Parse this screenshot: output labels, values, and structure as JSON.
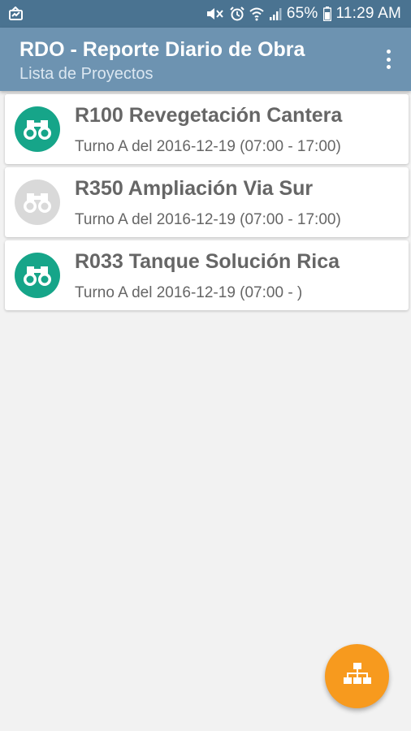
{
  "status_bar": {
    "battery_percent": "65%",
    "time": "11:29 AM",
    "icons": [
      "notification-icon",
      "mute-icon",
      "alarm-icon",
      "wifi-icon",
      "signal-icon",
      "battery-icon"
    ]
  },
  "app_bar": {
    "title": "RDO - Reporte Diario de Obra",
    "subtitle": "Lista de Proyectos",
    "menu_icon": "more-vert-icon"
  },
  "projects": [
    {
      "title": "R100  Revegetación Cantera",
      "subtitle": "Turno A  del 2016-12-19  (07:00 - 17:00)",
      "icon": "binoculars-icon",
      "icon_color": "#16a589"
    },
    {
      "title": "R350  Ampliación Via Sur",
      "subtitle": "Turno A  del 2016-12-19  (07:00 - 17:00)",
      "icon": "binoculars-icon",
      "icon_color": "#d9d9d9"
    },
    {
      "title": "R033  Tanque Solución Rica",
      "subtitle": "Turno A  del 2016-12-19  (07:00 - )",
      "icon": "binoculars-icon",
      "icon_color": "#16a589"
    }
  ],
  "fab": {
    "icon": "sitemap-icon",
    "color": "#f79a1e"
  }
}
